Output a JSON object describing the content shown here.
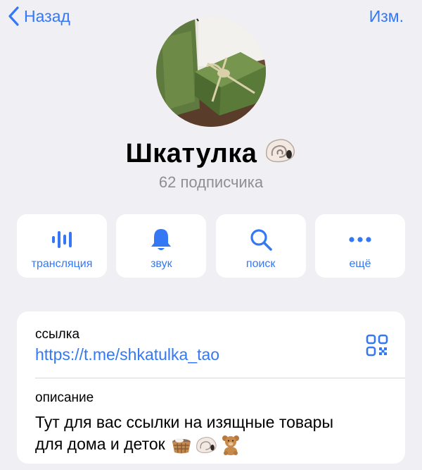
{
  "nav": {
    "back_label": "Назад",
    "edit_label": "Изм."
  },
  "channel": {
    "name": "Шкатулка",
    "name_emoji": "shell",
    "subscribers": "62 подписчика"
  },
  "actions": [
    {
      "label": "трансляция",
      "icon": "broadcast-icon"
    },
    {
      "label": "звук",
      "icon": "bell-icon"
    },
    {
      "label": "поиск",
      "icon": "search-icon"
    },
    {
      "label": "ещё",
      "icon": "more-icon"
    }
  ],
  "info": {
    "link_label": "ссылка",
    "link_value": "https://t.me/shkatulka_tao",
    "description_label": "описание",
    "description_line1": "Тут для вас ссылки на изящные товары",
    "description_line2": "для дома и деток",
    "description_emojis": [
      "basket",
      "shell",
      "teddy-bear"
    ]
  },
  "colors": {
    "accent": "#3478f6",
    "background": "#efeff4",
    "secondary_text": "#8e8e93"
  }
}
